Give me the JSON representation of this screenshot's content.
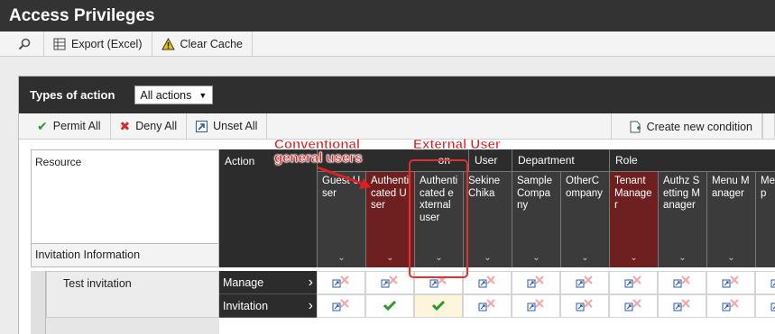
{
  "window": {
    "title": "Access Privileges"
  },
  "toolbar": {
    "export_label": "Export (Excel)",
    "clear_cache_label": "Clear Cache"
  },
  "panel": {
    "types_label": "Types of action",
    "select_value": "All actions",
    "permit_all": "Permit All",
    "deny_all": "Deny All",
    "unset_all": "Unset All",
    "create_condition": "Create new condition"
  },
  "grid": {
    "resource_header": "Resource",
    "action_header": "Action",
    "section_label": "Invitation Information",
    "groups": [
      "on",
      "User",
      "Department",
      "Role"
    ],
    "columns": [
      {
        "label": "Guest User",
        "highlight": false
      },
      {
        "label": "Authenticated User",
        "highlight": true
      },
      {
        "label": "Authenticated external user",
        "highlight": false
      },
      {
        "label": "Sekine Chika",
        "highlight": false
      },
      {
        "label": "Sample Company",
        "highlight": false
      },
      {
        "label": "OtherCompany",
        "highlight": false
      },
      {
        "label": "Tenant Manager",
        "highlight": true
      },
      {
        "label": "Authz Setting Manager",
        "highlight": false
      },
      {
        "label": "Menu Manager",
        "highlight": false
      },
      {
        "label": "Menu Op",
        "highlight": false
      }
    ],
    "resource_row": "Test invitation",
    "rows": [
      {
        "action": "Manage",
        "cells": [
          "unset",
          "unset",
          "unset",
          "unset",
          "unset",
          "unset",
          "unset",
          "unset",
          "unset",
          "unset"
        ]
      },
      {
        "action": "Invitation",
        "cells": [
          "unset",
          "permit",
          "permit",
          "unset",
          "unset",
          "unset",
          "unset",
          "unset",
          "unset",
          "unset"
        ]
      }
    ]
  },
  "annotations": {
    "conventional": [
      "Conventional",
      "general users"
    ],
    "external": "External User"
  },
  "colors": {
    "accent_red": "#e03030",
    "permit_green": "#2a9a2a",
    "deny_red": "#e04040",
    "header_dark": "#333333"
  }
}
